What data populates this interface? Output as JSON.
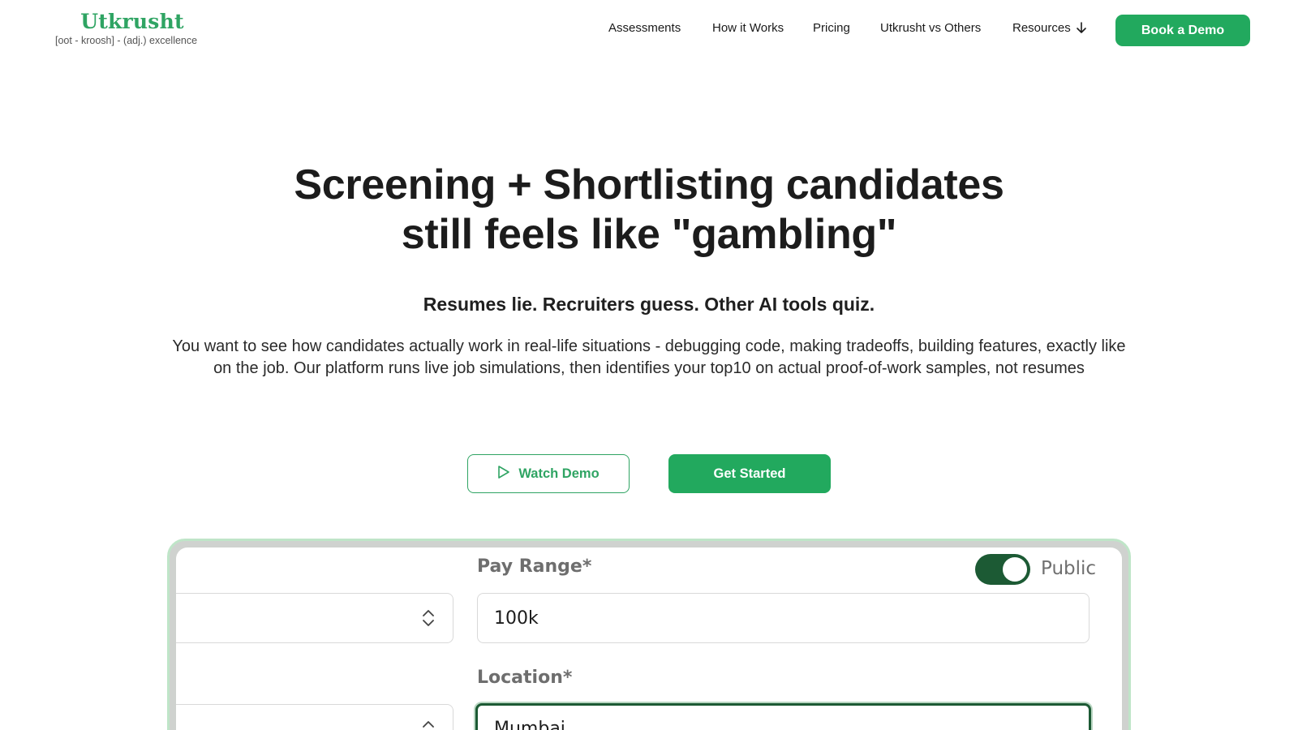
{
  "brand": {
    "name": "Utkrusht",
    "tagline": "[oot - kroosh] - (adj.) excellence",
    "color": "#2fa463"
  },
  "nav": {
    "items": [
      {
        "label": "Assessments"
      },
      {
        "label": "How it Works"
      },
      {
        "label": "Pricing"
      },
      {
        "label": "Utkrusht vs Others"
      },
      {
        "label": "Resources",
        "icon": "arrow-down-icon"
      }
    ],
    "cta_label": "Book a Demo"
  },
  "hero": {
    "title_line1": "Screening + Shortlisting candidates",
    "title_line2": "still feels like \"gambling\"",
    "subtitle": "Resumes lie. Recruiters guess. Other AI tools quiz.",
    "description": "You want to see how candidates actually work in real-life situations - debugging code, making tradeoffs, building features, exactly like on the job. Our platform runs live job simulations, then identifies your top10 on actual proof-of-work samples, not resumes",
    "watch_demo_label": "Watch Demo",
    "watch_demo_icon": "play-icon",
    "get_started_label": "Get Started"
  },
  "preview": {
    "pay_range_label": "Pay Range*",
    "pay_range_value": "100k",
    "public_label": "Public",
    "public_toggle_on": true,
    "location_label": "Location*",
    "location_value": "Mumbai"
  },
  "colors": {
    "accent": "#22a95e",
    "toggle": "#1c5a34",
    "preview_border": "#bfe5c8"
  }
}
